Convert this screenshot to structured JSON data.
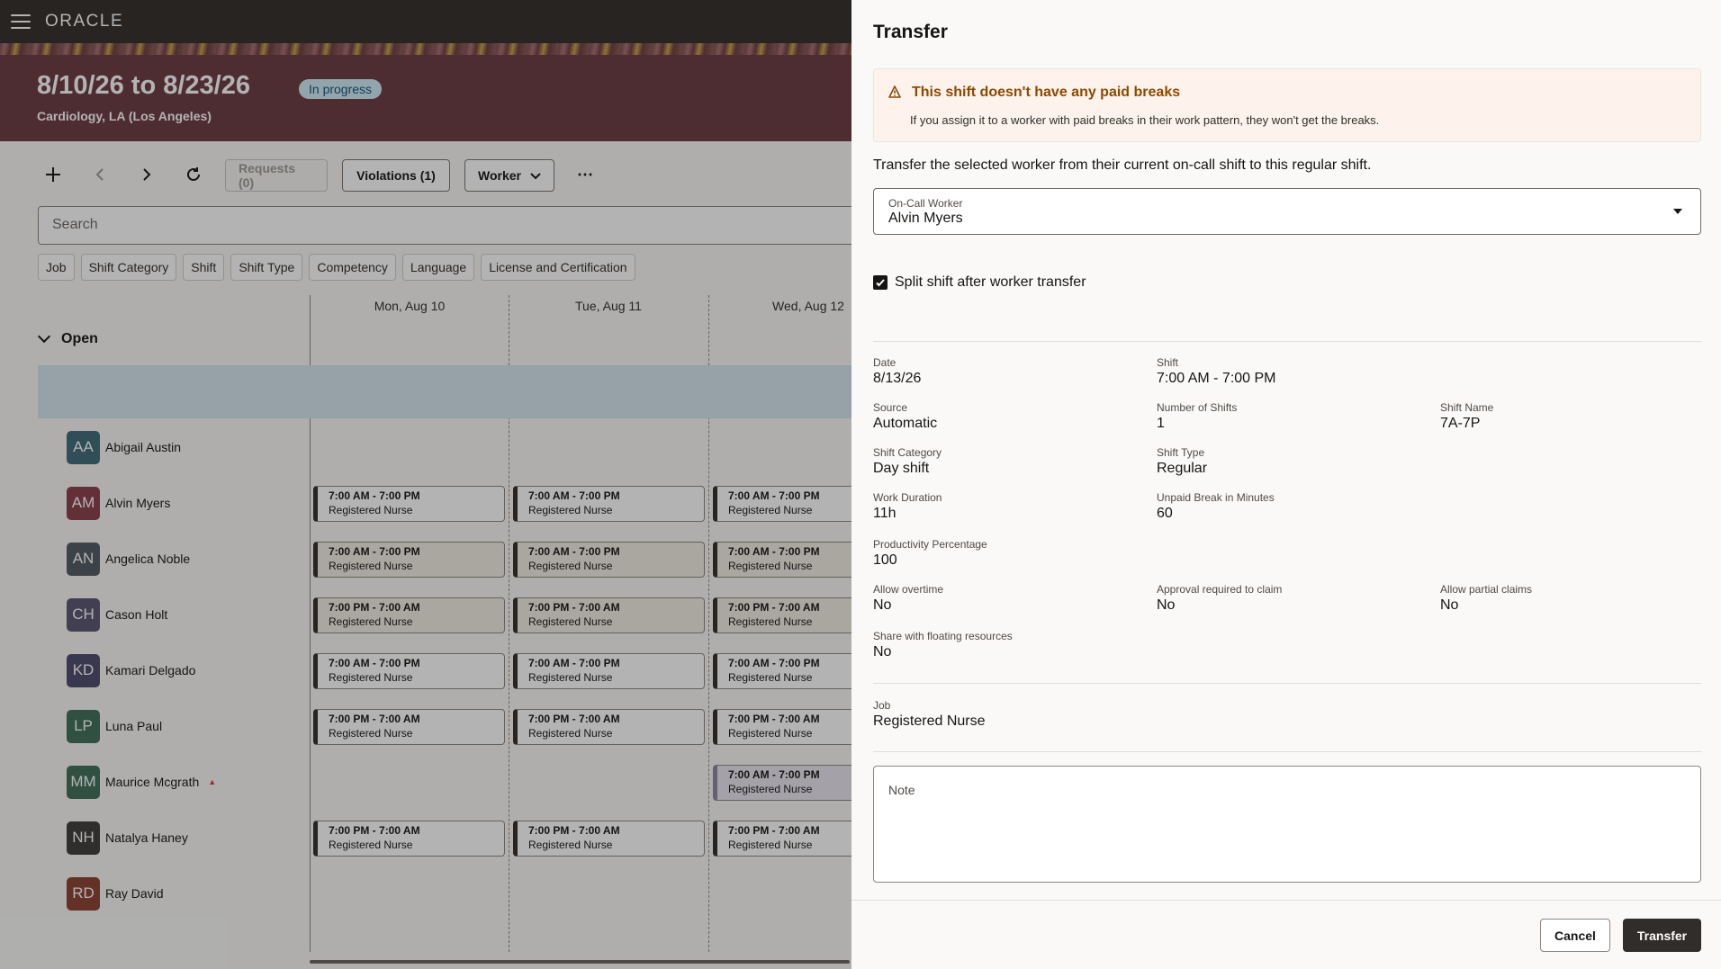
{
  "app": {
    "logo": "ORACLE",
    "title": "8/10/26 to 8/23/26",
    "status": "In progress",
    "subtitle": "Cardiology, LA (Los Angeles)",
    "toolbar": {
      "requests": "Requests (0)",
      "violations": "Violations (1)",
      "worker": "Worker"
    },
    "search_placeholder": "Search",
    "filters": [
      "Job",
      "Shift Category",
      "Shift",
      "Shift Type",
      "Competency",
      "Language",
      "License and Certification"
    ],
    "days": [
      "Mon, Aug 10",
      "Tue, Aug 11",
      "Wed, Aug 12"
    ],
    "group": "Open",
    "workers": [
      {
        "initials": "AA",
        "name": "Abigail Austin",
        "color": "#3d6b78"
      },
      {
        "initials": "AM",
        "name": "Alvin Myers",
        "color": "#8a3d4a"
      },
      {
        "initials": "AN",
        "name": "Angelica Noble",
        "color": "#4f5a62"
      },
      {
        "initials": "CH",
        "name": "Cason Holt",
        "color": "#5a5570"
      },
      {
        "initials": "KD",
        "name": "Kamari Delgado",
        "color": "#4d4a6b"
      },
      {
        "initials": "LP",
        "name": "Luna Paul",
        "color": "#3f6e58"
      },
      {
        "initials": "MM",
        "name": "Maurice Mcgrath",
        "color": "#3f6e58"
      },
      {
        "initials": "NH",
        "name": "Natalya Haney",
        "color": "#3e3c3a"
      },
      {
        "initials": "RD",
        "name": "Ray David",
        "color": "#8a4030"
      }
    ],
    "shift_day": "7:00 AM - 7:00 PM",
    "shift_night": "7:00 PM - 7:00 AM",
    "shift_job": "Registered Nurse"
  },
  "drawer": {
    "title": "Transfer",
    "alert": {
      "title": "This shift doesn't have any paid breaks",
      "text": "If you assign it to a worker with paid breaks in their work pattern, they won't get the breaks."
    },
    "intro": "Transfer the selected worker from their current on-call shift to this regular shift.",
    "on_call_label": "On-Call Worker",
    "on_call_value": "Alvin Myers",
    "split_label": "Split shift after worker transfer",
    "fields": {
      "date": {
        "label": "Date",
        "value": "8/13/26"
      },
      "shift": {
        "label": "Shift",
        "value": "7:00 AM - 7:00 PM"
      },
      "source": {
        "label": "Source",
        "value": "Automatic"
      },
      "num_shifts": {
        "label": "Number of Shifts",
        "value": "1"
      },
      "shift_name": {
        "label": "Shift Name",
        "value": "7A-7P"
      },
      "shift_category": {
        "label": "Shift Category",
        "value": "Day shift"
      },
      "shift_type": {
        "label": "Shift Type",
        "value": "Regular"
      },
      "work_duration": {
        "label": "Work Duration",
        "value": "11h"
      },
      "unpaid_break": {
        "label": "Unpaid Break in Minutes",
        "value": "60"
      },
      "productivity": {
        "label": "Productivity Percentage",
        "value": "100"
      },
      "allow_overtime": {
        "label": "Allow overtime",
        "value": "No"
      },
      "approval": {
        "label": "Approval required to claim",
        "value": "No"
      },
      "partial": {
        "label": "Allow partial claims",
        "value": "No"
      },
      "floating": {
        "label": "Share with floating resources",
        "value": "No"
      },
      "job": {
        "label": "Job",
        "value": "Registered Nurse"
      }
    },
    "note_label": "Note",
    "cancel": "Cancel",
    "transfer": "Transfer"
  }
}
